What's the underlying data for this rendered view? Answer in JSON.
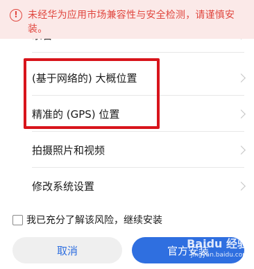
{
  "warning": {
    "icon": "exclamation-circle-icon",
    "text": "未经华为应用市场兼容性与安全检测，请谨慎安装。",
    "color": "#e0473f",
    "background": "#fbe9e8"
  },
  "permissions": [
    {
      "label": "录音"
    },
    {
      "label": "(基于网络的) 大概位置"
    },
    {
      "label": "精准的 (GPS) 位置"
    },
    {
      "label": "拍摄照片和视频"
    },
    {
      "label": "修改系统设置"
    }
  ],
  "highlight_color": "#d8141b",
  "consent": {
    "label": "我已充分了解该风险，继续安装",
    "checked": false
  },
  "buttons": {
    "cancel": "取消",
    "install": "官方安装"
  },
  "accent_color": "#2f6fe0",
  "watermark": {
    "brand": "Baidu 经验",
    "url": "jingyan.baidu.com"
  }
}
